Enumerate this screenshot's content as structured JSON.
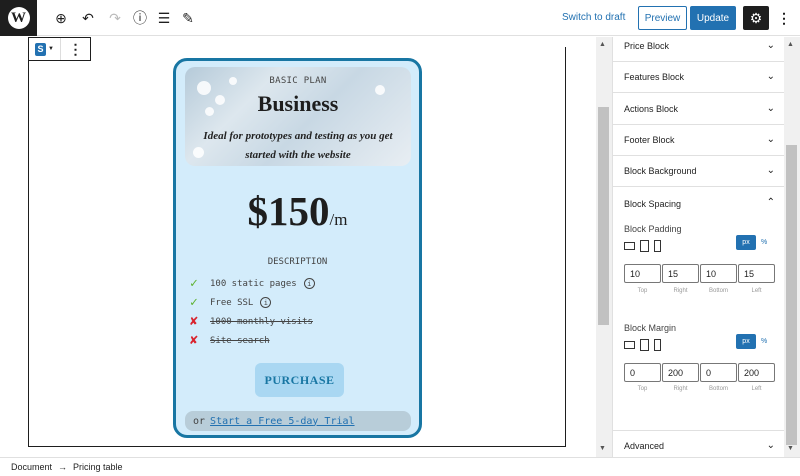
{
  "topbar": {
    "logo": "W",
    "icons": [
      "plus-circle-icon",
      "undo-icon",
      "redo-icon",
      "info-icon",
      "list-view-icon",
      "pencil-icon"
    ],
    "switch_to_draft": "Switch to draft",
    "preview": "Preview",
    "update": "Update"
  },
  "block_toolbar": {
    "icon": "S"
  },
  "card": {
    "plan_label": "BASIC PLAN",
    "title": "Business",
    "subtitle": "Ideal for prototypes and testing as you get started with the website",
    "price": "$150",
    "price_unit": "/m",
    "description_label": "DESCRIPTION",
    "features": [
      {
        "text": "100 static pages",
        "included": true,
        "info": true
      },
      {
        "text": "Free SSL",
        "included": true,
        "info": true
      },
      {
        "text": "1000 monthly visits",
        "included": false,
        "info": false
      },
      {
        "text": "Site search",
        "included": false,
        "info": false
      }
    ],
    "purchase": "PURCHASE",
    "trial_prefix": "or",
    "trial_link": "Start a Free 5-day Trial"
  },
  "sidebar": {
    "panels": [
      "Price Block",
      "Features Block",
      "Actions Block",
      "Footer Block",
      "Block Background",
      "Block Spacing"
    ],
    "block_padding": {
      "label": "Block Padding",
      "unit_px": "px",
      "unit_pct": "%",
      "values": [
        "10",
        "15",
        "10",
        "15"
      ],
      "captions": [
        "Top",
        "Right",
        "Bottom",
        "Left"
      ]
    },
    "block_margin": {
      "label": "Block Margin",
      "unit_px": "px",
      "unit_pct": "%",
      "values": [
        "0",
        "200",
        "0",
        "200"
      ],
      "captions": [
        "Top",
        "Right",
        "Bottom",
        "Left"
      ]
    },
    "advanced": "Advanced"
  },
  "breadcrumb": {
    "root": "Document",
    "arrow": "→",
    "current": "Pricing table"
  }
}
